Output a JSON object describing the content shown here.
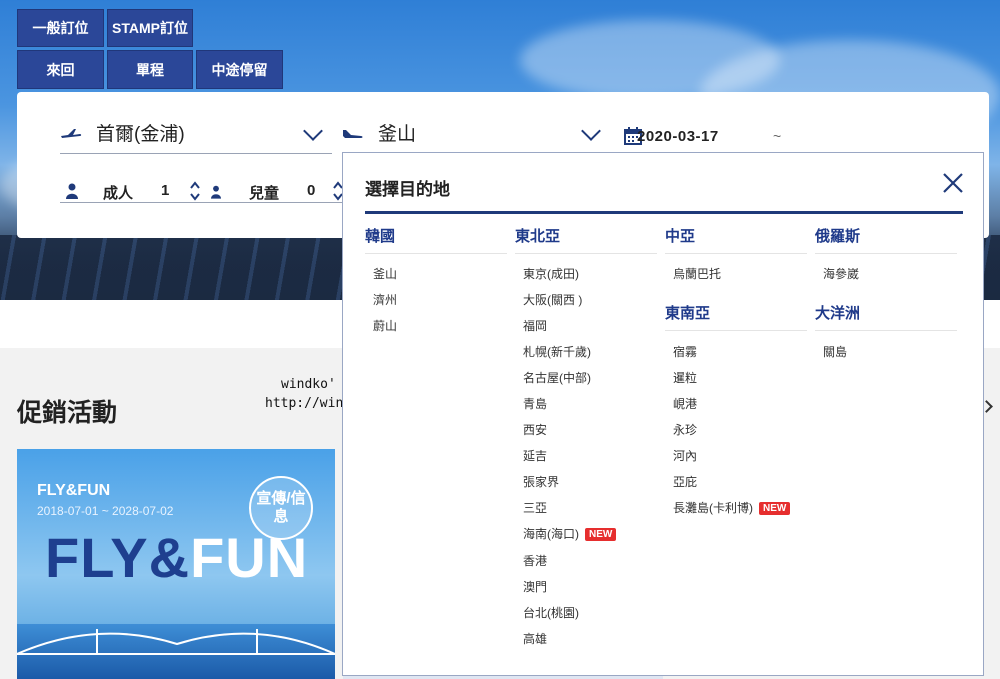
{
  "tabs": {
    "general_booking": "一般訂位",
    "stamp_booking": "STAMP訂位",
    "round_trip": "來回",
    "one_way": "單程",
    "stopover": "中途停留"
  },
  "search": {
    "origin": "首爾(金浦)",
    "destination": "釜山",
    "date": "2020-03-17",
    "date_separator": "~",
    "adult_label": "成人",
    "adult_count": "1",
    "child_label": "兒童",
    "child_count": "0"
  },
  "promo": {
    "section_title": "促銷活動",
    "card_title": "FLY&FUN",
    "card_dates": "2018-07-01 ~ 2028-07-02",
    "badge": "宣傳/信息",
    "big_fly": "FLY",
    "big_amp": "&",
    "big_fun": "FUN"
  },
  "watermark": {
    "line1": "windko' Blog",
    "line2": "http://windko.tw"
  },
  "popup": {
    "title": "選擇目的地",
    "new_label": "NEW",
    "korea": {
      "name": "韓國",
      "cities": [
        "釜山",
        "濟州",
        "蔚山"
      ]
    },
    "northeast_asia": {
      "name": "東北亞",
      "cities": [
        "東京(成田)",
        "大阪(關西 )",
        "福岡",
        "札幌(新千歲)",
        "名古屋(中部)",
        "青島",
        "西安",
        "延吉",
        "張家界",
        "三亞",
        "海南(海口)",
        "香港",
        "澳門",
        "台北(桃園)",
        "高雄"
      ]
    },
    "central_asia": {
      "name": "中亞",
      "cities": [
        "烏蘭巴托"
      ]
    },
    "southeast_asia": {
      "name": "東南亞",
      "cities": [
        "宿霧",
        "暹粒",
        "峴港",
        "永珍",
        "河內",
        "亞庇",
        "長灘島(卡利博)"
      ]
    },
    "russia": {
      "name": "俄羅斯",
      "cities": [
        "海參崴"
      ]
    },
    "oceania": {
      "name": "大洋洲",
      "cities": [
        "關島"
      ]
    }
  },
  "colors": {
    "brand_blue": "#2b4798",
    "region_blue": "#1f3a8a",
    "new_red": "#e62e2e"
  }
}
